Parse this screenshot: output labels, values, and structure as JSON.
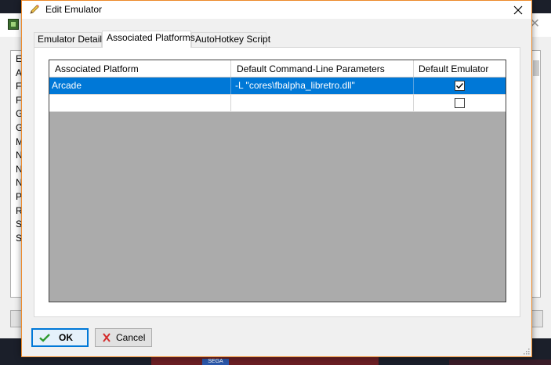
{
  "dialog": {
    "title": "Edit Emulator",
    "close_symbol": "close-icon"
  },
  "tabs": [
    {
      "label": "Emulator Details",
      "active": false
    },
    {
      "label": "Associated Platforms",
      "active": true
    },
    {
      "label": "AutoHotkey Script",
      "active": false
    }
  ],
  "grid": {
    "columns": [
      "Associated Platform",
      "Default Command-Line Parameters",
      "Default Emulator"
    ],
    "rows": [
      {
        "platform": "Arcade",
        "parameters": "-L \"cores\\fbalpha_libretro.dll\"",
        "default_emulator": true,
        "selected": true
      },
      {
        "platform": "",
        "parameters": "",
        "default_emulator": false,
        "selected": false
      }
    ]
  },
  "buttons": {
    "ok_label": "OK",
    "cancel_label": "Cancel"
  },
  "background": {
    "list_letters": [
      "E",
      "A",
      "F",
      "F",
      "G",
      "G",
      "M",
      "N",
      "N",
      "N",
      "P",
      "R",
      "S",
      "S"
    ],
    "sega_label": "SEGA"
  },
  "colors": {
    "selection": "#0078d7",
    "dialog_border": "#ed8a2a",
    "grid_empty": "#ababab",
    "ok_check": "#2e9a2e",
    "cancel_x": "#d42a2a"
  }
}
